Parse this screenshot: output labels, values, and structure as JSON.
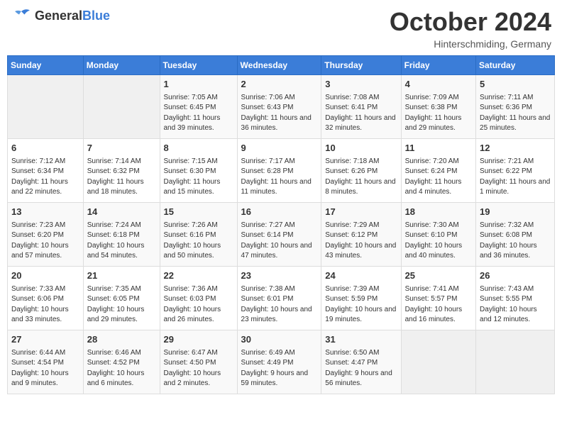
{
  "header": {
    "logo_general": "General",
    "logo_blue": "Blue",
    "month_title": "October 2024",
    "location": "Hinterschmiding, Germany"
  },
  "days_of_week": [
    "Sunday",
    "Monday",
    "Tuesday",
    "Wednesday",
    "Thursday",
    "Friday",
    "Saturday"
  ],
  "weeks": [
    [
      {
        "day": "",
        "content": ""
      },
      {
        "day": "",
        "content": ""
      },
      {
        "day": "1",
        "content": "Sunrise: 7:05 AM\nSunset: 6:45 PM\nDaylight: 11 hours and 39 minutes."
      },
      {
        "day": "2",
        "content": "Sunrise: 7:06 AM\nSunset: 6:43 PM\nDaylight: 11 hours and 36 minutes."
      },
      {
        "day": "3",
        "content": "Sunrise: 7:08 AM\nSunset: 6:41 PM\nDaylight: 11 hours and 32 minutes."
      },
      {
        "day": "4",
        "content": "Sunrise: 7:09 AM\nSunset: 6:38 PM\nDaylight: 11 hours and 29 minutes."
      },
      {
        "day": "5",
        "content": "Sunrise: 7:11 AM\nSunset: 6:36 PM\nDaylight: 11 hours and 25 minutes."
      }
    ],
    [
      {
        "day": "6",
        "content": "Sunrise: 7:12 AM\nSunset: 6:34 PM\nDaylight: 11 hours and 22 minutes."
      },
      {
        "day": "7",
        "content": "Sunrise: 7:14 AM\nSunset: 6:32 PM\nDaylight: 11 hours and 18 minutes."
      },
      {
        "day": "8",
        "content": "Sunrise: 7:15 AM\nSunset: 6:30 PM\nDaylight: 11 hours and 15 minutes."
      },
      {
        "day": "9",
        "content": "Sunrise: 7:17 AM\nSunset: 6:28 PM\nDaylight: 11 hours and 11 minutes."
      },
      {
        "day": "10",
        "content": "Sunrise: 7:18 AM\nSunset: 6:26 PM\nDaylight: 11 hours and 8 minutes."
      },
      {
        "day": "11",
        "content": "Sunrise: 7:20 AM\nSunset: 6:24 PM\nDaylight: 11 hours and 4 minutes."
      },
      {
        "day": "12",
        "content": "Sunrise: 7:21 AM\nSunset: 6:22 PM\nDaylight: 11 hours and 1 minute."
      }
    ],
    [
      {
        "day": "13",
        "content": "Sunrise: 7:23 AM\nSunset: 6:20 PM\nDaylight: 10 hours and 57 minutes."
      },
      {
        "day": "14",
        "content": "Sunrise: 7:24 AM\nSunset: 6:18 PM\nDaylight: 10 hours and 54 minutes."
      },
      {
        "day": "15",
        "content": "Sunrise: 7:26 AM\nSunset: 6:16 PM\nDaylight: 10 hours and 50 minutes."
      },
      {
        "day": "16",
        "content": "Sunrise: 7:27 AM\nSunset: 6:14 PM\nDaylight: 10 hours and 47 minutes."
      },
      {
        "day": "17",
        "content": "Sunrise: 7:29 AM\nSunset: 6:12 PM\nDaylight: 10 hours and 43 minutes."
      },
      {
        "day": "18",
        "content": "Sunrise: 7:30 AM\nSunset: 6:10 PM\nDaylight: 10 hours and 40 minutes."
      },
      {
        "day": "19",
        "content": "Sunrise: 7:32 AM\nSunset: 6:08 PM\nDaylight: 10 hours and 36 minutes."
      }
    ],
    [
      {
        "day": "20",
        "content": "Sunrise: 7:33 AM\nSunset: 6:06 PM\nDaylight: 10 hours and 33 minutes."
      },
      {
        "day": "21",
        "content": "Sunrise: 7:35 AM\nSunset: 6:05 PM\nDaylight: 10 hours and 29 minutes."
      },
      {
        "day": "22",
        "content": "Sunrise: 7:36 AM\nSunset: 6:03 PM\nDaylight: 10 hours and 26 minutes."
      },
      {
        "day": "23",
        "content": "Sunrise: 7:38 AM\nSunset: 6:01 PM\nDaylight: 10 hours and 23 minutes."
      },
      {
        "day": "24",
        "content": "Sunrise: 7:39 AM\nSunset: 5:59 PM\nDaylight: 10 hours and 19 minutes."
      },
      {
        "day": "25",
        "content": "Sunrise: 7:41 AM\nSunset: 5:57 PM\nDaylight: 10 hours and 16 minutes."
      },
      {
        "day": "26",
        "content": "Sunrise: 7:43 AM\nSunset: 5:55 PM\nDaylight: 10 hours and 12 minutes."
      }
    ],
    [
      {
        "day": "27",
        "content": "Sunrise: 6:44 AM\nSunset: 4:54 PM\nDaylight: 10 hours and 9 minutes."
      },
      {
        "day": "28",
        "content": "Sunrise: 6:46 AM\nSunset: 4:52 PM\nDaylight: 10 hours and 6 minutes."
      },
      {
        "day": "29",
        "content": "Sunrise: 6:47 AM\nSunset: 4:50 PM\nDaylight: 10 hours and 2 minutes."
      },
      {
        "day": "30",
        "content": "Sunrise: 6:49 AM\nSunset: 4:49 PM\nDaylight: 9 hours and 59 minutes."
      },
      {
        "day": "31",
        "content": "Sunrise: 6:50 AM\nSunset: 4:47 PM\nDaylight: 9 hours and 56 minutes."
      },
      {
        "day": "",
        "content": ""
      },
      {
        "day": "",
        "content": ""
      }
    ]
  ]
}
